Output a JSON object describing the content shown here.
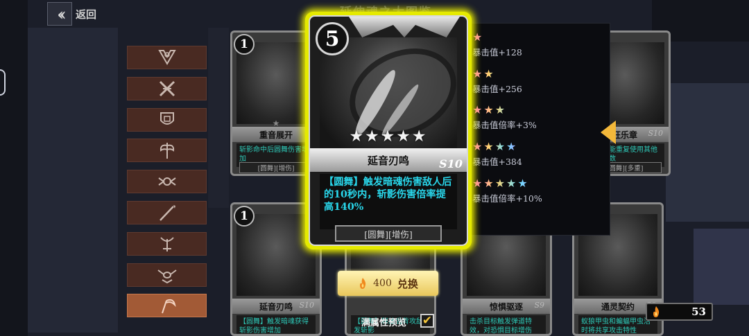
{
  "header": {
    "back_label": "返回",
    "title": "延伸魂之大图鉴"
  },
  "categories": [
    {
      "icon": "crest-icon"
    },
    {
      "icon": "crossed-swords-icon"
    },
    {
      "icon": "shield-emblem-icon"
    },
    {
      "icon": "double-axe-icon"
    },
    {
      "icon": "winged-orb-icon"
    },
    {
      "icon": "spear-icon"
    },
    {
      "icon": "bow-icon"
    },
    {
      "icon": "winged-eye-icon"
    },
    {
      "icon": "scythe-icon",
      "active": true
    }
  ],
  "cards_top": [
    {
      "cost": "1",
      "name": "重音展开",
      "desc": "斩影命中后圆舞伤害增加",
      "tags": "[圆舞][增伤]",
      "level": ""
    },
    {
      "cost": "",
      "name": "狂乐章",
      "desc": "附加技能重复使用其他技能层数",
      "tags": "[圆舞][多重]",
      "level": "S10"
    }
  ],
  "cards_bottom": [
    {
      "cost": "1",
      "name": "延音刃鸣",
      "desc": "【圆舞】触发暗魂获得斩影伤害增加",
      "tags": "",
      "level": "S10"
    },
    {
      "cost": "",
      "name": "",
      "desc": "【圆舞】释放后背攻敌发斩影",
      "tags": "",
      "level": ""
    },
    {
      "cost": "",
      "name": "惊惧驱逐",
      "desc": "击杀目标触发弹道特效，对恐惧目标增伤",
      "tags": "",
      "level": "S9"
    },
    {
      "cost": "",
      "name": "通灵契约",
      "desc": "蚁狼甲虫和蝙蝠甲虫活时将共享攻击特性",
      "tags": "",
      "level": "S9"
    }
  ],
  "featured": {
    "cost": "5",
    "stars": "★★★★★",
    "name": "延音刃鸣",
    "level": "S10",
    "desc": "【圆舞】触发暗魂伤害敌人后的10秒内，斩影伤害倍率提高140%",
    "tags": "[圆舞][增伤]"
  },
  "star_levels": [
    {
      "stars": "★",
      "bonus": "暴击值+128"
    },
    {
      "stars": "★★",
      "bonus": "暴击值+256"
    },
    {
      "stars": "★★★",
      "bonus": "暴击值倍率+3%"
    },
    {
      "stars": "★★★★",
      "bonus": "暴击值+384"
    },
    {
      "stars": "★★★★★",
      "bonus": "暴击值倍率+10%"
    }
  ],
  "exchange": {
    "price": "400",
    "label": "兑换"
  },
  "preview": {
    "label": "满属性预览",
    "checked": "✔"
  },
  "currency": {
    "amount": "53"
  },
  "colors": {
    "highlight": "#e5ea00",
    "desc_text": "#29d6ea",
    "button": "#e9c75b",
    "category_bg": "#492a22",
    "category_active": "#a25a36"
  }
}
